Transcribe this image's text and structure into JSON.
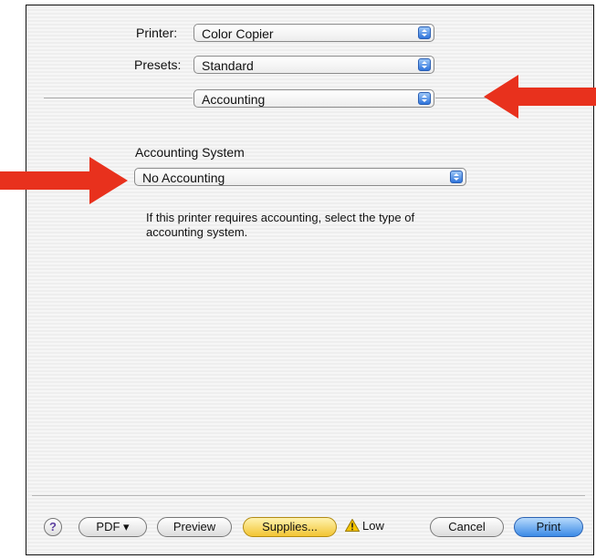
{
  "printer": {
    "label": "Printer:",
    "value": "Color Copier"
  },
  "presets": {
    "label": "Presets:",
    "value": "Standard"
  },
  "panel": {
    "value": "Accounting"
  },
  "accounting_system": {
    "label": "Accounting System",
    "value": "No Accounting",
    "description": "If this printer requires accounting, select the type of accounting system."
  },
  "footer": {
    "help_label": "?",
    "pdf_label": "PDF ▾",
    "preview_label": "Preview",
    "supplies_label": "Supplies...",
    "low_label": "Low",
    "cancel_label": "Cancel",
    "print_label": "Print"
  },
  "colors": {
    "arrow": "#e8311d",
    "stepper_blue": "#2f74db",
    "supplies_yellow": "#f2c432",
    "print_blue": "#3b8ae6"
  },
  "icons": [
    "popup-stepper-icon",
    "warning-icon",
    "red-arrow-left-icon",
    "red-arrow-right-icon"
  ]
}
